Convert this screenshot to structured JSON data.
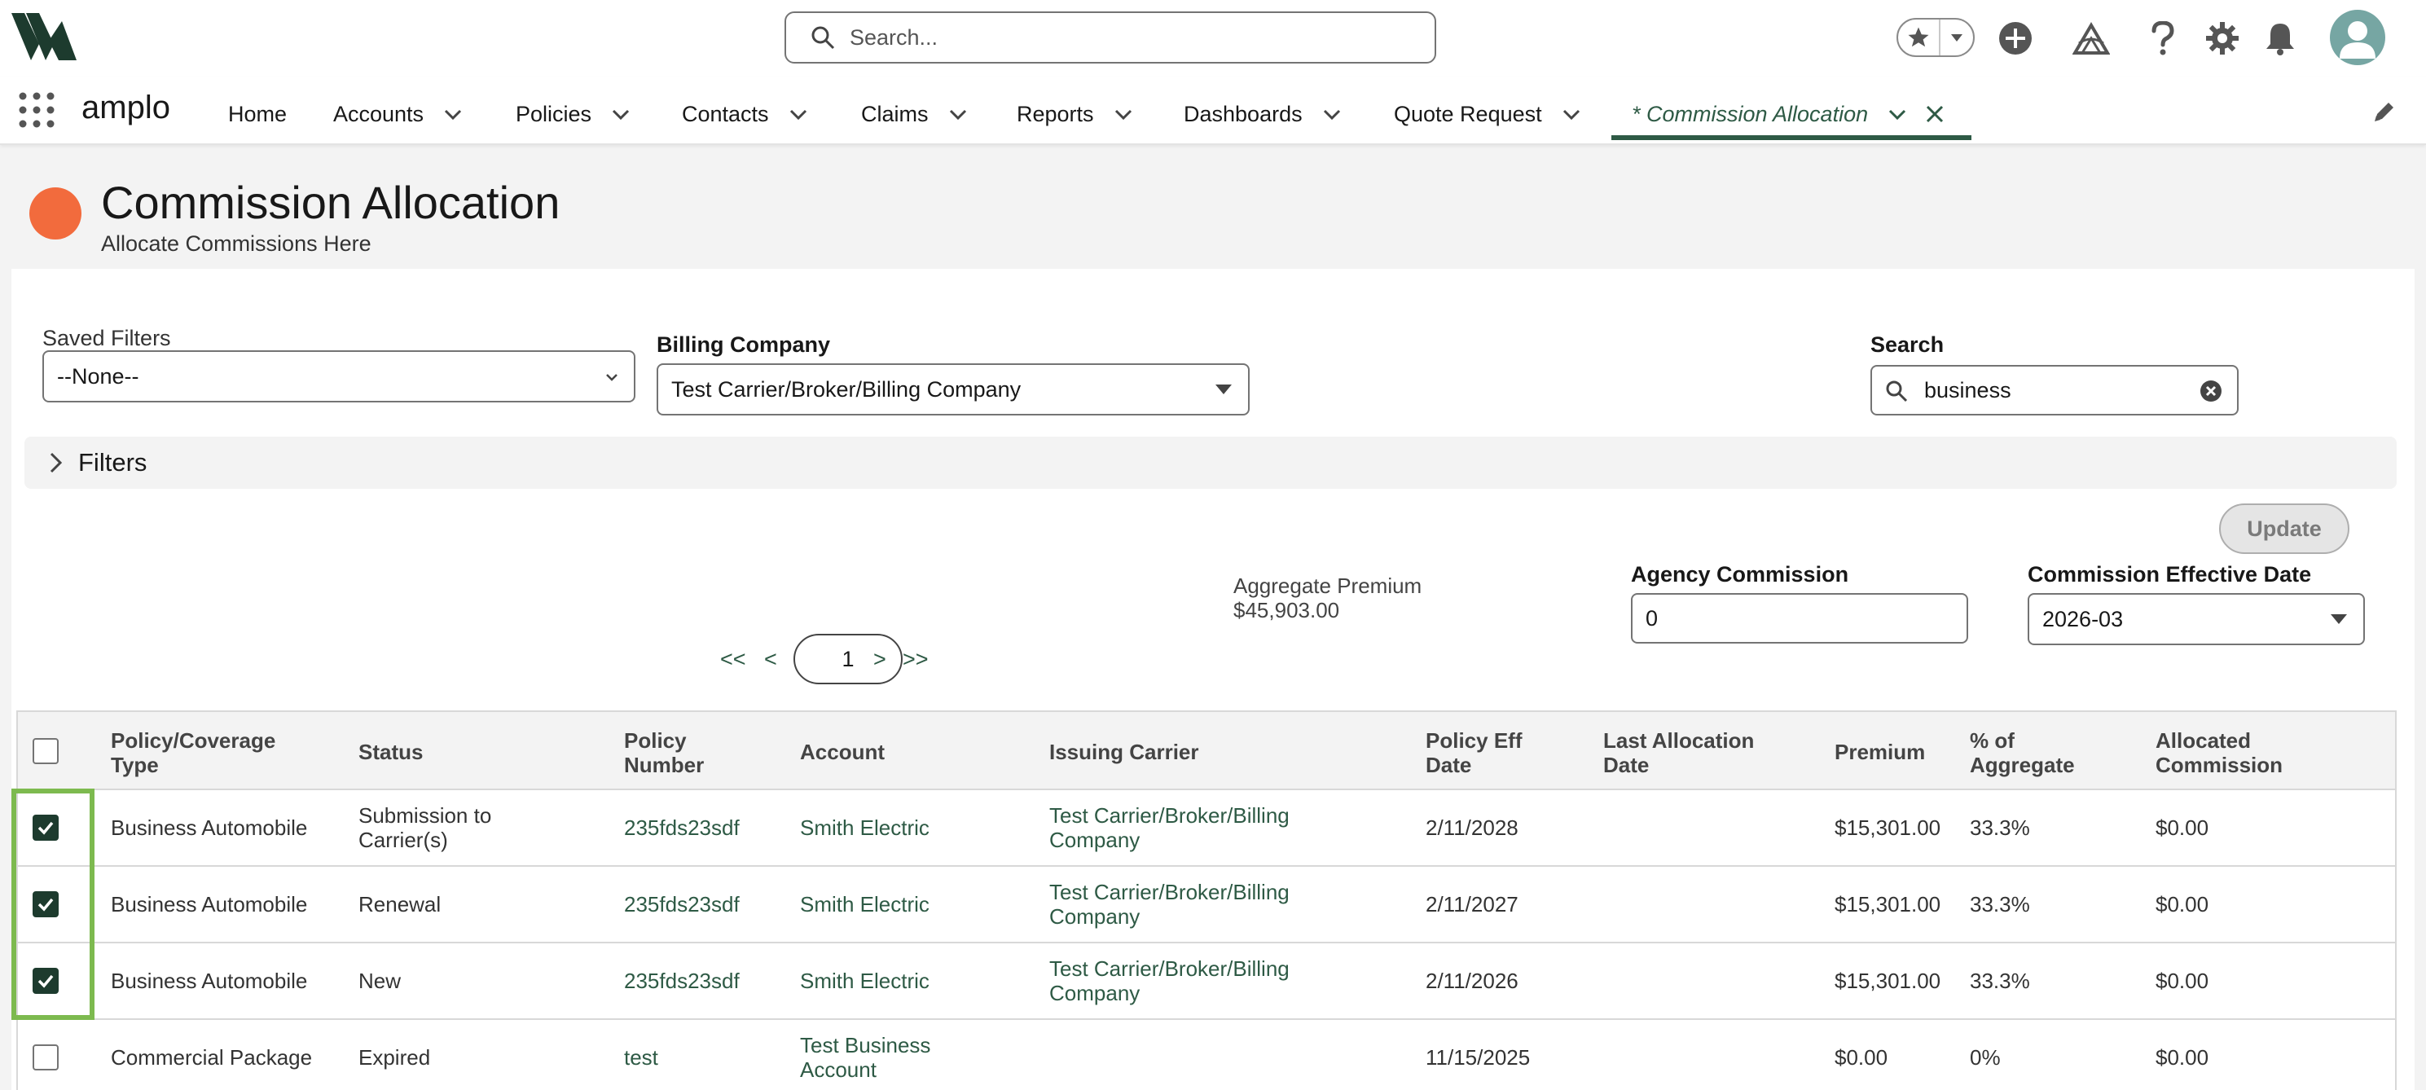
{
  "header": {
    "search_placeholder": "Search...",
    "brand_color": "#2e5a45",
    "icons": [
      "star-icon",
      "chevron-down-icon",
      "add-icon",
      "trailhead-icon",
      "help-icon",
      "setup-gear-icon",
      "notification-bell-icon",
      "user-avatar"
    ]
  },
  "nav": {
    "app_name": "amplo",
    "items": [
      {
        "label": "Home"
      },
      {
        "label": "Accounts"
      },
      {
        "label": "Policies"
      },
      {
        "label": "Contacts"
      },
      {
        "label": "Claims"
      },
      {
        "label": "Reports"
      },
      {
        "label": "Dashboards"
      },
      {
        "label": "Quote Request"
      },
      {
        "label": "* Commission Allocation"
      }
    ]
  },
  "page": {
    "title": "Commission Allocation",
    "subtitle": "Allocate Commissions Here",
    "icon_color": "#f26b3d"
  },
  "filters": {
    "saved_filters_label": "Saved Filters",
    "saved_filters_value": "--None--",
    "billing_company_label": "Billing Company",
    "billing_company_value": "Test Carrier/Broker/Billing Company",
    "search_label": "Search",
    "search_value": "business",
    "filters_toggle_label": "Filters"
  },
  "allocation": {
    "update_label": "Update",
    "aggregate_premium_label": "Aggregate Premium",
    "aggregate_premium_value": "$45,903.00",
    "agency_commission_label": "Agency Commission",
    "agency_commission_value": "0",
    "effective_date_label": "Commission Effective Date",
    "effective_date_value": "2026-03"
  },
  "pager": {
    "first": "<<",
    "prev": "<",
    "current": "1",
    "next": ">",
    "last": ">>"
  },
  "table": {
    "columns": {
      "type": "Policy/Coverage Type",
      "status": "Status",
      "policy_number": "Policy Number",
      "account": "Account",
      "carrier": "Issuing Carrier",
      "eff_date": "Policy Eff Date",
      "last_alloc": "Last Allocation Date",
      "premium": "Premium",
      "pct": "% of Aggregate",
      "alloc_commission": "Allocated Commission"
    },
    "rows": [
      {
        "checked": true,
        "type": "Business Automobile",
        "status": "Submission to Carrier(s)",
        "policy_number": "235fds23sdf",
        "account": "Smith Electric",
        "carrier": "Test Carrier/Broker/Billing Company",
        "eff_date": "2/11/2028",
        "last_alloc": "",
        "premium": "$15,301.00",
        "pct": "33.3%",
        "alloc_commission": "$0.00"
      },
      {
        "checked": true,
        "type": "Business Automobile",
        "status": "Renewal",
        "policy_number": "235fds23sdf",
        "account": "Smith Electric",
        "carrier": "Test Carrier/Broker/Billing Company",
        "eff_date": "2/11/2027",
        "last_alloc": "",
        "premium": "$15,301.00",
        "pct": "33.3%",
        "alloc_commission": "$0.00"
      },
      {
        "checked": true,
        "type": "Business Automobile",
        "status": "New",
        "policy_number": "235fds23sdf",
        "account": "Smith Electric",
        "carrier": "Test Carrier/Broker/Billing Company",
        "eff_date": "2/11/2026",
        "last_alloc": "",
        "premium": "$15,301.00",
        "pct": "33.3%",
        "alloc_commission": "$0.00"
      },
      {
        "checked": false,
        "type": "Commercial Package",
        "status": "Expired",
        "policy_number": "test",
        "account": "Test Business Account",
        "carrier": "",
        "eff_date": "11/15/2025",
        "last_alloc": "",
        "premium": "$0.00",
        "pct": "0%",
        "alloc_commission": "$0.00"
      }
    ]
  }
}
